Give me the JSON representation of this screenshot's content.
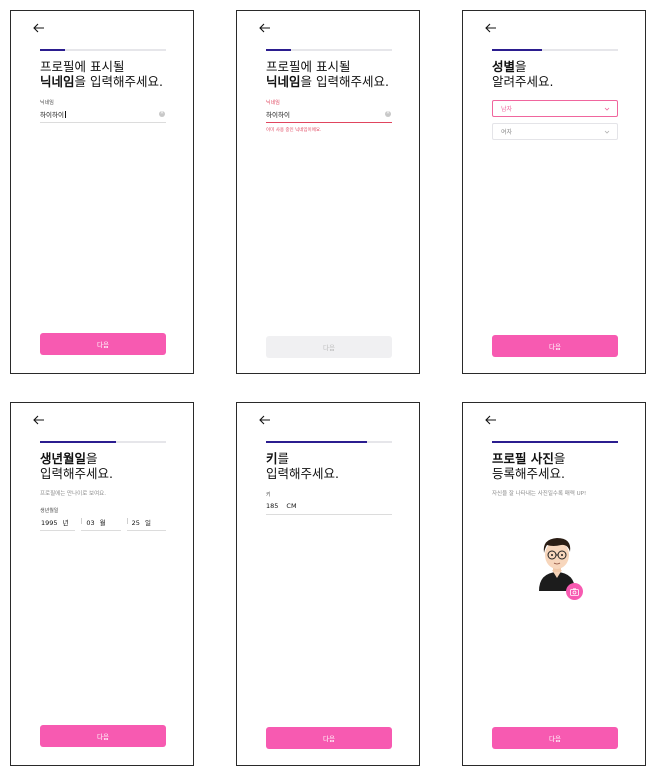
{
  "screens": [
    {
      "id": "nickname",
      "progress": 0.2,
      "title_line1": "프로필에 표시될",
      "title_bold": "닉네임",
      "title_rest": "을 입력해주세요.",
      "field_label": "닉네임",
      "field_value": "하이하이",
      "next_label": "다음"
    },
    {
      "id": "nickname-error",
      "progress": 0.2,
      "title_line1": "프로필에 표시될",
      "title_bold": "닉네임",
      "title_rest": "을 입력해주세요.",
      "field_label": "닉네임",
      "field_value": "하이하이",
      "error_message": "이미 사용 중인 닉네임이에요.",
      "next_label": "다음",
      "next_disabled": true
    },
    {
      "id": "gender",
      "progress": 0.4,
      "title_bold": "성별",
      "title_rest": "을",
      "title_line2": "알려주세요.",
      "options": [
        "남자",
        "여자"
      ],
      "selected": "남자",
      "next_label": "다음"
    },
    {
      "id": "birthday",
      "progress": 0.6,
      "title_bold": "생년월일",
      "title_rest": "을",
      "title_line2": "입력해주세요.",
      "subtitle": "프로필에는 만나이로 보여요.",
      "field_label": "생년월일",
      "year": "1995",
      "year_unit": "년",
      "month": "03",
      "month_unit": "월",
      "day": "25",
      "day_unit": "일",
      "next_label": "다음"
    },
    {
      "id": "height",
      "progress": 0.8,
      "title_bold": "키",
      "title_rest": "를",
      "title_line2": "입력해주세요.",
      "field_label": "키",
      "value": "185",
      "unit": "CM",
      "next_label": "다음"
    },
    {
      "id": "photo",
      "progress": 1.0,
      "title_bold": "프로필 사진",
      "title_rest": "을",
      "title_line2": "등록해주세요.",
      "subtitle": "자신을 잘 나타내는 사진일수록 매력 UP!",
      "next_label": "다음"
    }
  ],
  "colors": {
    "accent": "#f75ab1",
    "progress": "#2b1d8f",
    "error": "#e0455e"
  },
  "icons": {
    "back": "arrow-left-icon",
    "clear": "clear-circle-icon",
    "chevron": "chevron-down-icon",
    "camera": "camera-icon"
  }
}
